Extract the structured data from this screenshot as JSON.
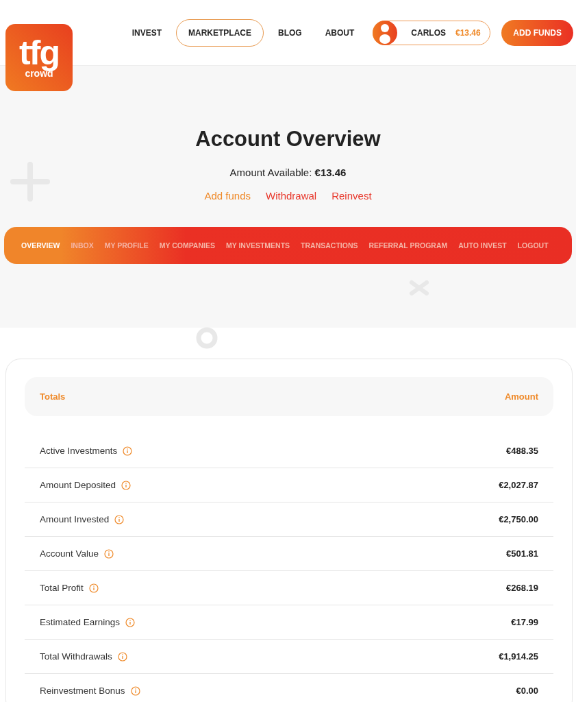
{
  "logo": {
    "mark": "tfg",
    "sub": "crowd"
  },
  "nav": [
    {
      "label": "INVEST",
      "selected": false
    },
    {
      "label": "MARKETPLACE",
      "selected": true
    },
    {
      "label": "BLOG",
      "selected": false
    },
    {
      "label": "ABOUT",
      "selected": false
    }
  ],
  "account": {
    "name": "CARLOS",
    "balance": "€13.46"
  },
  "add_funds_button": "ADD FUNDS",
  "title": "Account Overview",
  "available": "Amount Available: **€13.46**",
  "actions": [
    {
      "label": "Add funds",
      "kind": "primary"
    },
    {
      "label": "Withdrawal",
      "kind": "secondary"
    },
    {
      "label": "Reinvest",
      "kind": "secondary"
    }
  ],
  "tabs": [
    {
      "label": "OVERVIEW",
      "selected": true
    },
    {
      "label": "INBOX",
      "selected": false
    },
    {
      "label": "MY PROFILE",
      "selected": false
    },
    {
      "label": "MY COMPANIES",
      "selected": false
    },
    {
      "label": "MY INVESTMENTS",
      "selected": false
    },
    {
      "label": "TRANSACTIONS",
      "selected": false
    },
    {
      "label": "REFERRAL PROGRAM",
      "selected": false
    },
    {
      "label": "AUTO INVEST",
      "selected": false
    },
    {
      "label": "LOGOUT",
      "selected": false
    }
  ],
  "table": {
    "columns": [
      "Totals",
      "Amount"
    ],
    "rows": [
      {
        "label": "Active Investments",
        "value": "€488.35"
      },
      {
        "label": "Amount Deposited",
        "value": "€2,027.87"
      },
      {
        "label": "Amount Invested",
        "value": "€2,750.00"
      },
      {
        "label": "Account Value",
        "value": "€501.81"
      },
      {
        "label": "Total Profit",
        "value": "€268.19"
      },
      {
        "label": "Estimated Earnings",
        "value": "€17.99"
      },
      {
        "label": "Total Withdrawals",
        "value": "€1,914.25"
      },
      {
        "label": "Reinvestment Bonus",
        "value": "€0.00"
      }
    ]
  }
}
